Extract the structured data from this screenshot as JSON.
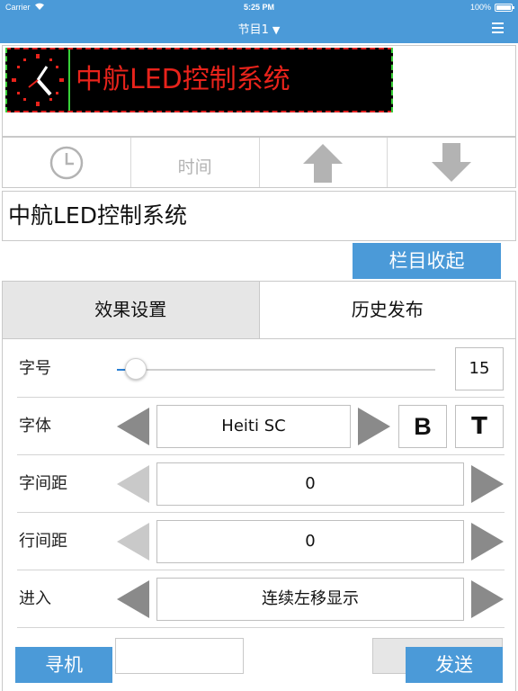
{
  "status_bar": {
    "carrier": "Carrier",
    "time": "5:25 PM",
    "battery": "100%"
  },
  "nav": {
    "title": "节目1",
    "caret": "▼",
    "menu_icon": "hamburger-menu-icon"
  },
  "preview": {
    "led_text": "中航LED控制系统",
    "led_text_color": "#e8231b",
    "border_colors": [
      "#e02020",
      "#38d038"
    ],
    "clock_icon": "analog-clock-icon"
  },
  "toolbar": {
    "clock_icon": "clock-icon",
    "time_label": "时间",
    "up_icon": "arrow-up-icon",
    "down_icon": "arrow-down-icon"
  },
  "text_input": {
    "value": "中航LED控制系统"
  },
  "collapse_button": "栏目收起",
  "tabs": [
    {
      "label": "效果设置",
      "active": true
    },
    {
      "label": "历史发布",
      "active": false
    }
  ],
  "settings": {
    "font_size": {
      "label": "字号",
      "value": "15",
      "level": 0.06
    },
    "font_face": {
      "label": "字体",
      "value": "Heiti SC",
      "bold_label": "B",
      "text_style_label": "T"
    },
    "letter_spacing": {
      "label": "字间距",
      "value": "0"
    },
    "line_spacing": {
      "label": "行间距",
      "value": "0"
    },
    "entry": {
      "label": "进入",
      "value": "连续左移显示"
    }
  },
  "bottom": {
    "search_button": "寻机",
    "send_button": "发送"
  },
  "colors": {
    "accent": "#4b9ad8",
    "tab_active_bg": "#e6e6e6",
    "slider_fill": "#2a7fd4"
  }
}
